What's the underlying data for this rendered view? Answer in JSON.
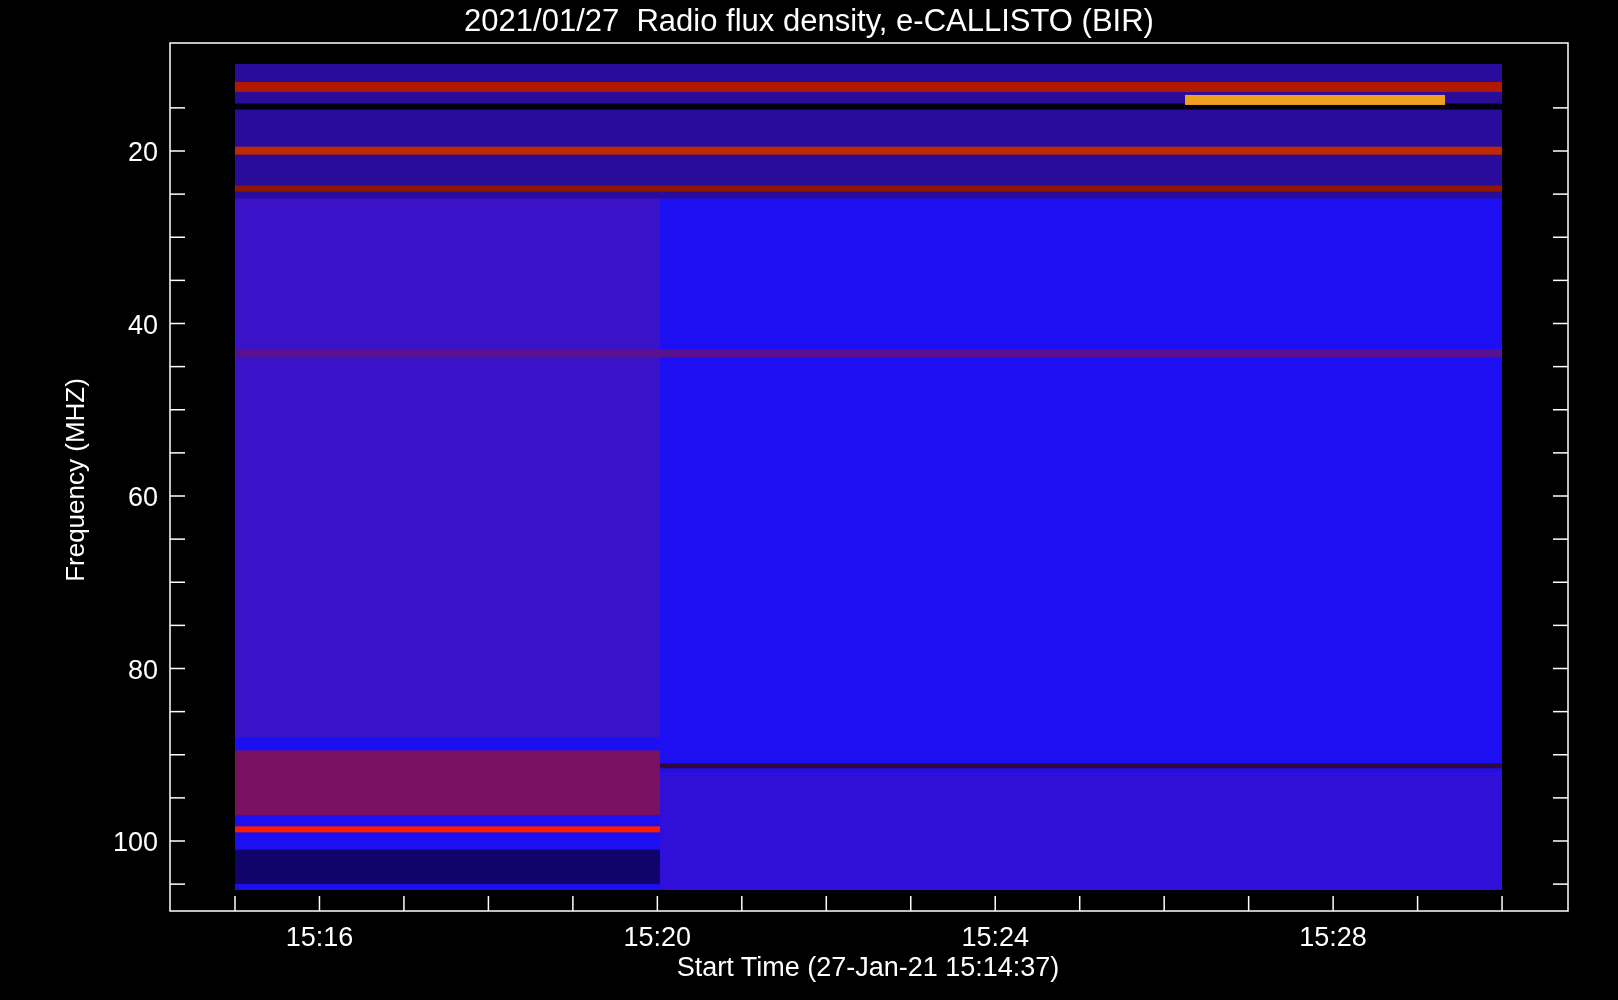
{
  "title": "2021/01/27  Radio flux density, e-CALLISTO (BIR)",
  "y_axis": {
    "label": "Frequency (MHZ)",
    "ticks": [
      "20",
      "40",
      "60",
      "80",
      "100"
    ]
  },
  "x_axis": {
    "label": "Start Time (27-Jan-21 15:14:37)",
    "ticks": [
      "15:16",
      "15:20",
      "15:24",
      "15:28"
    ]
  }
}
